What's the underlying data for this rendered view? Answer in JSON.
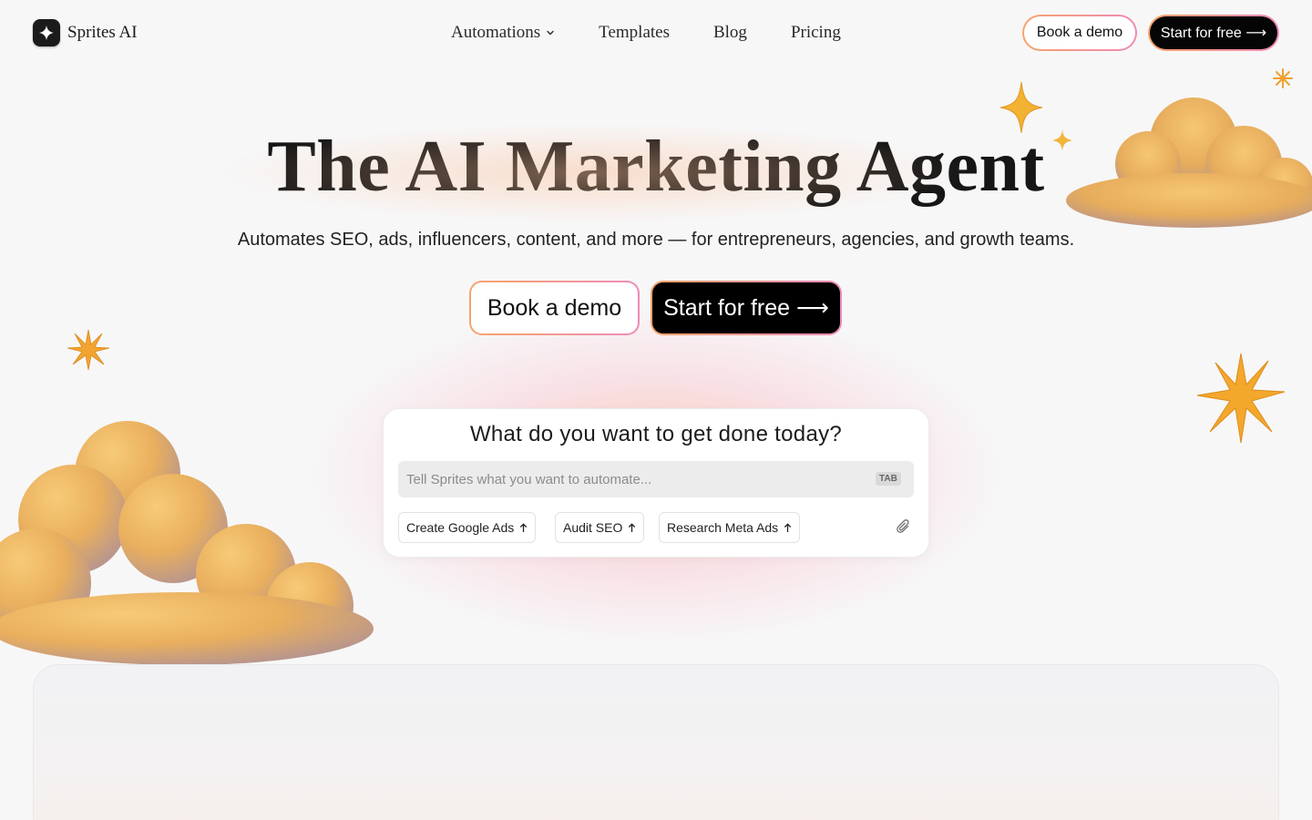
{
  "brand": {
    "name": "Sprites AI",
    "logo_icon": "sparkle-icon"
  },
  "nav": {
    "items": [
      {
        "label": "Automations",
        "has_dropdown": true
      },
      {
        "label": "Templates"
      },
      {
        "label": "Blog"
      },
      {
        "label": "Pricing"
      }
    ]
  },
  "header": {
    "demo_label": "Book a demo",
    "start_label": "Start for free ⟶"
  },
  "hero": {
    "title": "The AI Marketing Agent",
    "subtitle": "Automates SEO, ads, influencers, content, and more — for entrepreneurs, agencies, and growth teams.",
    "demo_label": "Book a demo",
    "start_label": "Start for free ⟶"
  },
  "prompt_card": {
    "title": "What do you want to get done today?",
    "input_value": "",
    "placeholder": "Tell Sprites what you want to automate...",
    "tab_hint": "TAB",
    "chips": [
      {
        "label": "Create Google Ads",
        "icon": "arrow-up-icon"
      },
      {
        "label": "Audit SEO",
        "icon": "arrow-up-icon"
      },
      {
        "label": "Research Meta Ads",
        "icon": "arrow-up-icon"
      }
    ],
    "attach_icon": "paperclip-icon"
  },
  "colors": {
    "accent_orange": "#f6a46a",
    "accent_pink": "#f08bb8",
    "cloud": "#e9b45c",
    "star": "#f0a52a"
  }
}
